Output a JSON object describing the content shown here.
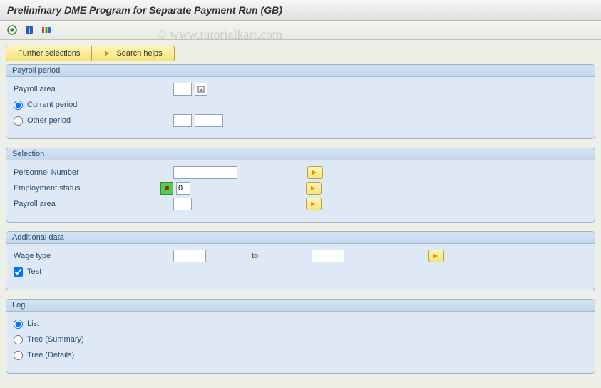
{
  "title": "Preliminary DME Program for Separate Payment Run (GB)",
  "watermark": "© www.tutorialkart.com",
  "buttons": {
    "further": "Further selections",
    "search": "Search helps"
  },
  "groups": {
    "payroll_period": {
      "title": "Payroll period",
      "payroll_area_label": "Payroll area",
      "payroll_area_value": "",
      "current_period": "Current period",
      "other_period": "Other period",
      "other_from": "",
      "other_to": ""
    },
    "selection": {
      "title": "Selection",
      "pernr_label": "Personnel Number",
      "pernr_value": "",
      "emp_status_label": "Employment status",
      "emp_status_value": "0",
      "payroll_area_label": "Payroll area",
      "payroll_area_value": ""
    },
    "additional": {
      "title": "Additional data",
      "wage_type_label": "Wage type",
      "wage_type_from": "",
      "to_label": "to",
      "wage_type_to": "",
      "test_label": "Test"
    },
    "log": {
      "title": "Log",
      "list": "List",
      "tree_summary": "Tree (Summary)",
      "tree_details": "Tree (Details)"
    }
  }
}
